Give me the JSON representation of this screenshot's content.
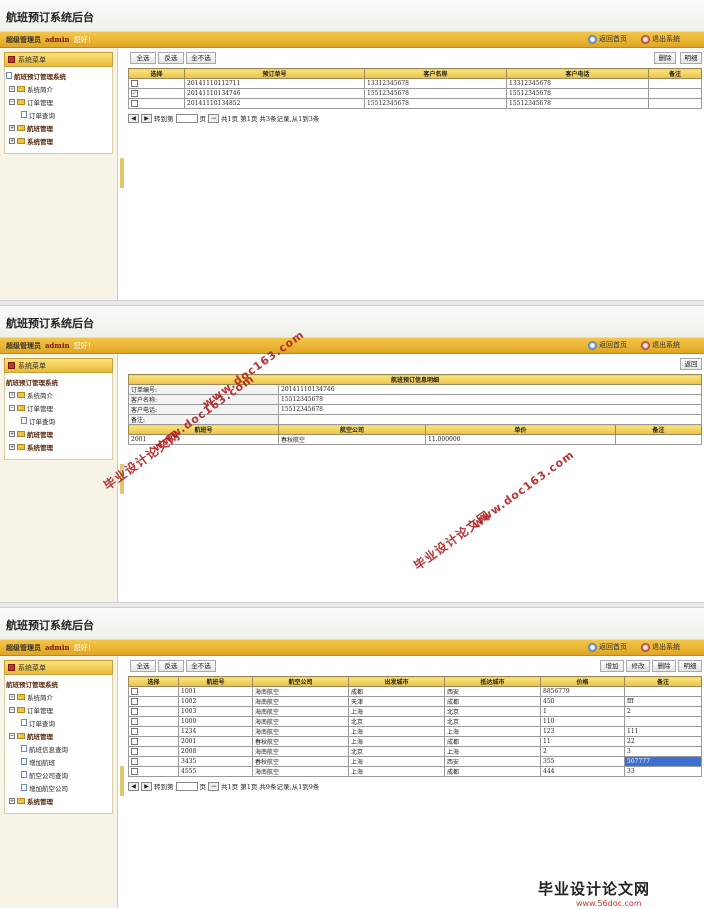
{
  "app_title": "航班预订系统后台",
  "topbar": {
    "role": "超级管理员",
    "user": "admin",
    "greeting": "您好！",
    "home_link": "返回首页",
    "exit_link": "退出系统"
  },
  "menu_header": "系统菜单",
  "panel1": {
    "tree": [
      "航班预订管理系统",
      "系统简介",
      "订单管理",
      "订单查询",
      "航班管理",
      "系统管理"
    ],
    "buttons": {
      "select_all": "全选",
      "invert": "反选",
      "select_none": "全不选",
      "delete": "删除",
      "detail": "明细"
    },
    "columns": [
      "选择",
      "预订单号",
      "客户名称",
      "客户电话",
      "备注"
    ],
    "rows": [
      {
        "checked": false,
        "order_no": "20141110112711",
        "name": "13312345678",
        "phone": "13312345678",
        "note": ""
      },
      {
        "checked": true,
        "order_no": "20141110134746",
        "name": "15512345678",
        "phone": "15512345678",
        "note": ""
      },
      {
        "checked": false,
        "order_no": "20141110134852",
        "name": "15512345678",
        "phone": "15512345678",
        "note": ""
      }
    ],
    "pager": {
      "goto": "转到第",
      "page_unit": "页",
      "go": "→",
      "summary": "共1页 第1页 共3条记录,从1到3条"
    }
  },
  "panel2": {
    "tree": [
      "航班预订管理系统",
      "系统简介",
      "订单管理",
      "订单查询",
      "航班管理",
      "系统管理"
    ],
    "back": "返回",
    "detail_title": "航班预订信息明细",
    "fields": [
      {
        "label": "订单编号:",
        "value": "20141110134746"
      },
      {
        "label": "客户名称:",
        "value": "15512345678"
      },
      {
        "label": "客户电话:",
        "value": "15512345678"
      },
      {
        "label": "备注:",
        "value": ""
      }
    ],
    "columns": [
      "航班号",
      "航空公司",
      "单价",
      "备注"
    ],
    "rows": [
      {
        "flight": "2001",
        "airline": "春秋航空",
        "price": "11.000000",
        "note": ""
      }
    ]
  },
  "panel3": {
    "tree": [
      "航班预订管理系统",
      "系统简介",
      "订单管理",
      "订单查询",
      "航班管理",
      "航班信息查询",
      "增加航班",
      "航空公司查询",
      "增加航空公司",
      "系统管理"
    ],
    "buttons": {
      "select_all": "全选",
      "invert": "反选",
      "select_none": "全不选",
      "add": "增加",
      "edit": "修改",
      "delete": "删除",
      "detail": "明细"
    },
    "columns": [
      "选择",
      "航班号",
      "航空公司",
      "出发城市",
      "抵达城市",
      "价格",
      "备注"
    ],
    "rows": [
      {
        "no": "1001",
        "airline": "海南航空",
        "from": "成都",
        "to": "西安",
        "price": "8856779",
        "note": ""
      },
      {
        "no": "1002",
        "airline": "海南航空",
        "from": "天津",
        "to": "成都",
        "price": "450",
        "note": "fff"
      },
      {
        "no": "1003",
        "airline": "海南航空",
        "from": "上海",
        "to": "北京",
        "price": "1",
        "note": "2"
      },
      {
        "no": "1009",
        "airline": "海南航空",
        "from": "北京",
        "to": "北京",
        "price": "110",
        "note": ""
      },
      {
        "no": "1234",
        "airline": "海南航空",
        "from": "上海",
        "to": "上海",
        "price": "123",
        "note": "111"
      },
      {
        "no": "2001",
        "airline": "春秋航空",
        "from": "上海",
        "to": "成都",
        "price": "11",
        "note": "22"
      },
      {
        "no": "2008",
        "airline": "海南航空",
        "from": "北京",
        "to": "上海",
        "price": "2",
        "note": "3"
      },
      {
        "no": "3435",
        "airline": "春秋航空",
        "from": "上海",
        "to": "西安",
        "price": "355",
        "note": "567777"
      },
      {
        "no": "4555",
        "airline": "海南航空",
        "from": "上海",
        "to": "成都",
        "price": "444",
        "note": "33"
      }
    ],
    "pager": {
      "goto": "转到第",
      "page_unit": "页",
      "go": "→",
      "summary": "共1页 第1页 共9条记录,从1到9条"
    }
  },
  "watermarks": {
    "cn": "毕业设计论文网",
    "url": "www.doc163.com"
  },
  "brand": {
    "name": "毕业设计论文网",
    "url": "www.56doc.com"
  }
}
